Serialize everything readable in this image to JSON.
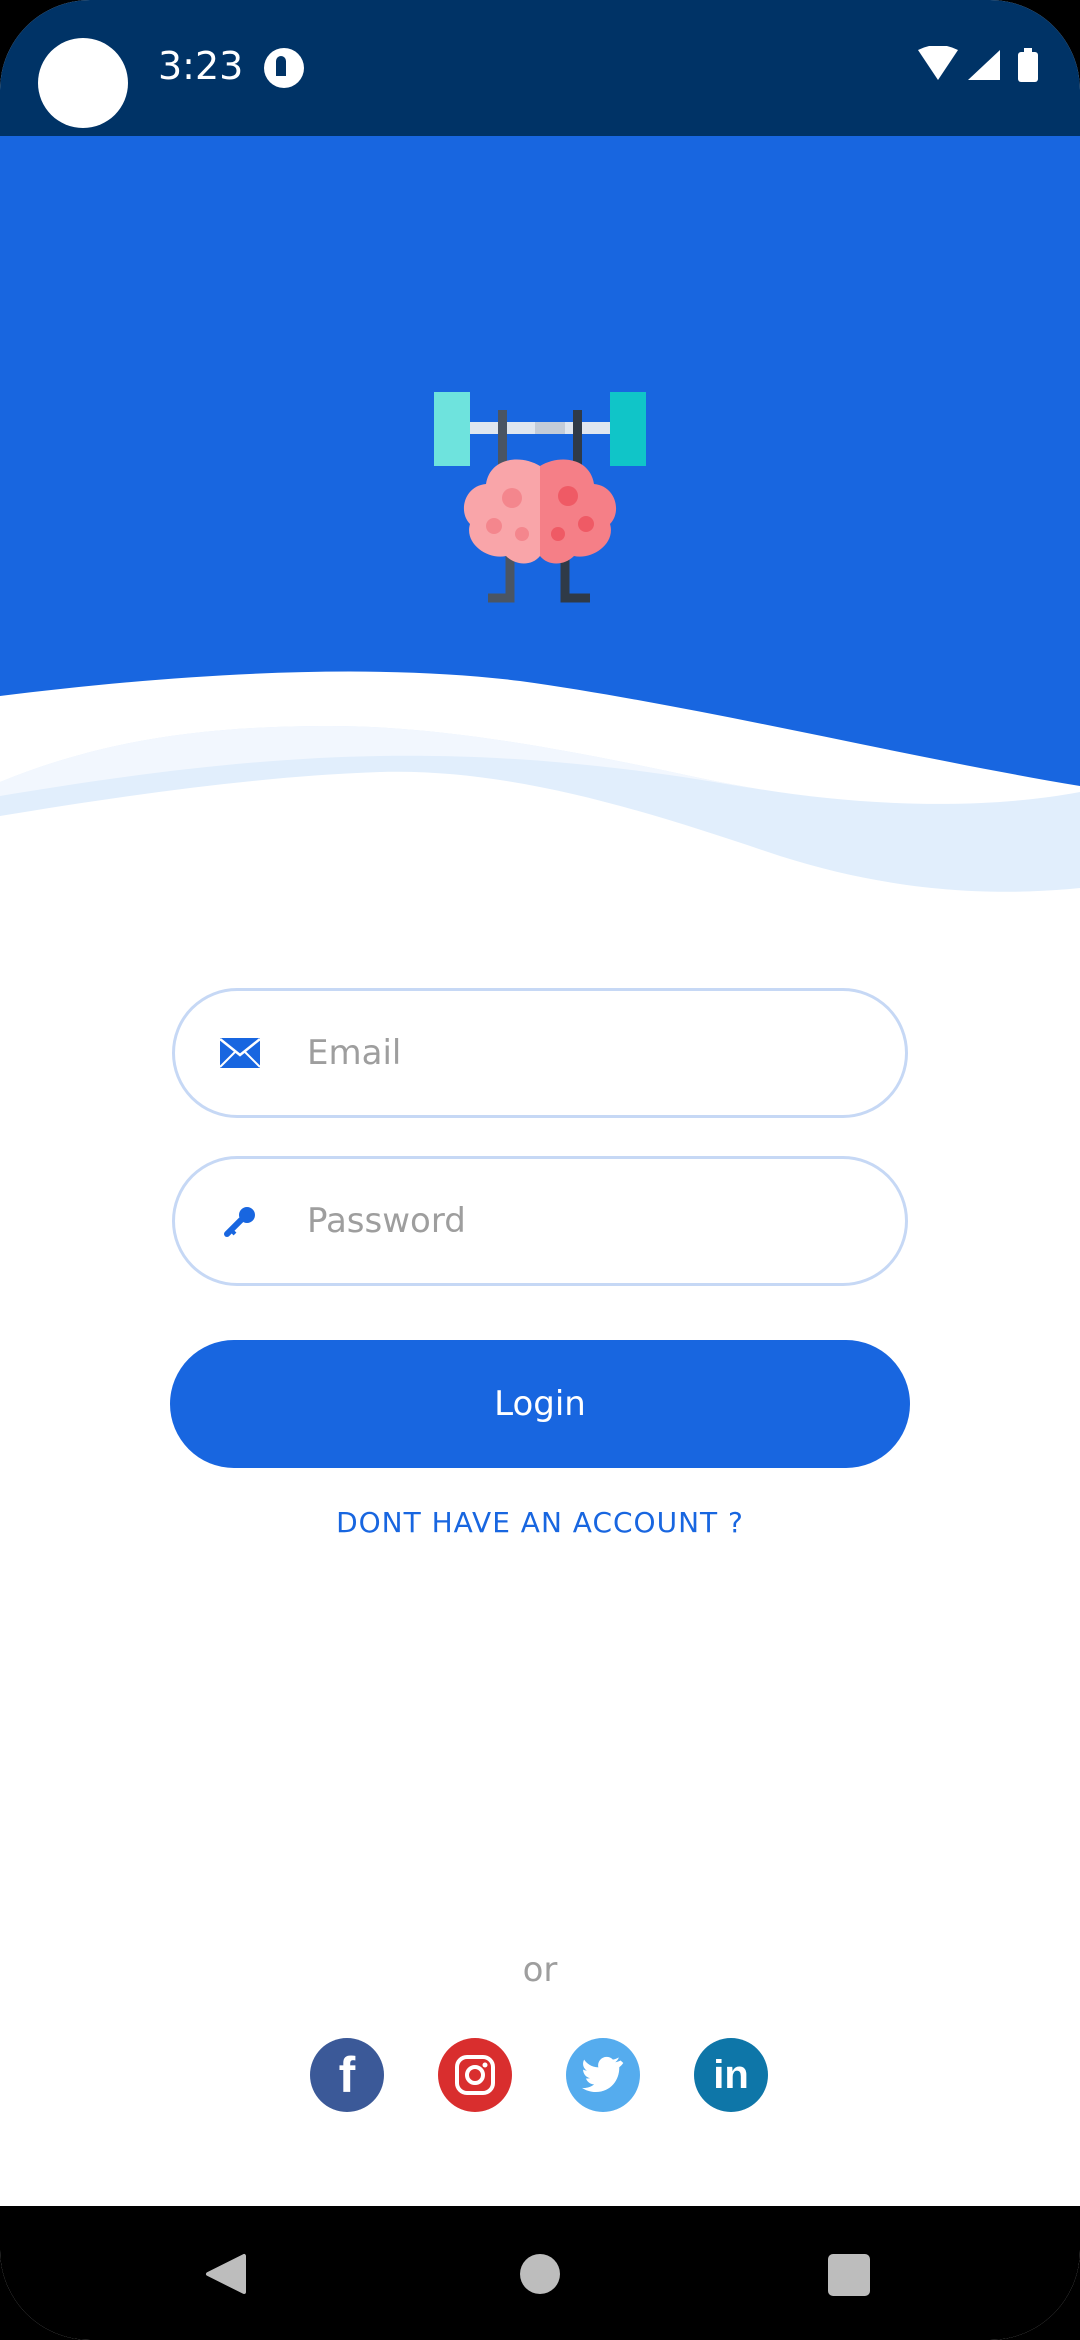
{
  "status_bar": {
    "time": "3:23"
  },
  "login": {
    "email_placeholder": "Email",
    "password_placeholder": "Password",
    "login_label": "Login",
    "signup_link": "DONT HAVE AN ACCOUNT ?",
    "or_text": "or"
  },
  "social": {
    "facebook_glyph": "f",
    "linkedin_glyph": "in"
  },
  "colors": {
    "status_bar": "#003366",
    "primary": "#1866e0",
    "field_border": "#c6d8f5",
    "placeholder": "#9e9e9e"
  },
  "icons": {
    "email": "envelope-icon",
    "password": "key-icon",
    "logo": "brain-barbell-icon"
  }
}
